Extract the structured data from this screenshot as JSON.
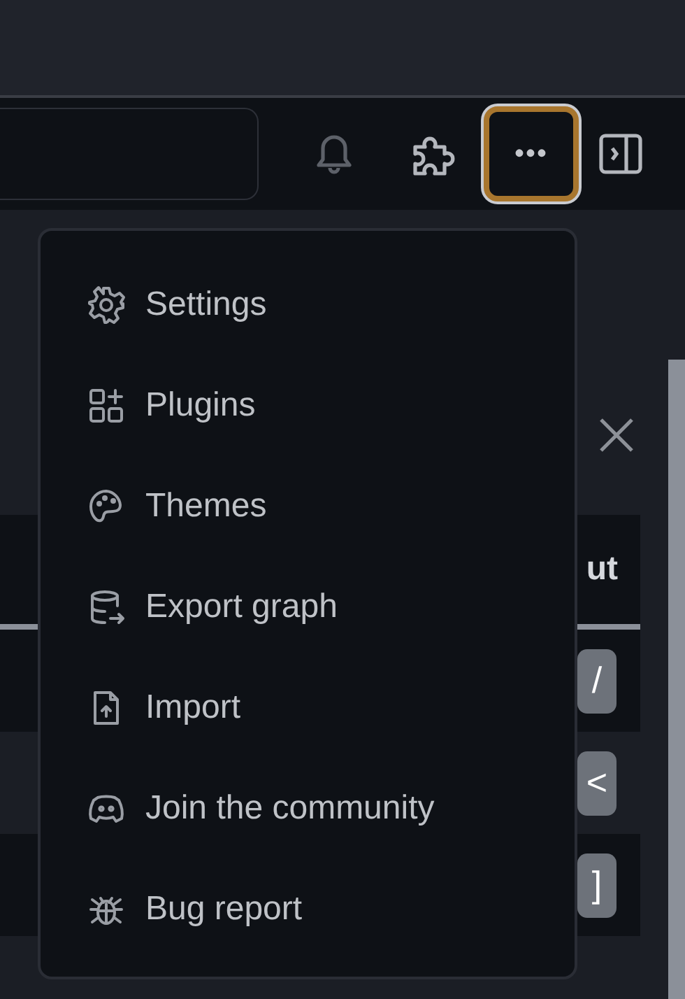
{
  "header": {
    "more_button": {
      "label": "•••",
      "focused": true
    }
  },
  "menu": {
    "items": [
      {
        "label": "Settings"
      },
      {
        "label": "Plugins"
      },
      {
        "label": "Themes"
      },
      {
        "label": "Export graph"
      },
      {
        "label": "Import"
      },
      {
        "label": "Join the community"
      },
      {
        "label": "Bug report"
      }
    ]
  },
  "shortcuts": {
    "column_1": "ut",
    "rows": [
      {
        "key": "/"
      },
      {
        "key": "<"
      },
      {
        "key": "]"
      }
    ]
  }
}
